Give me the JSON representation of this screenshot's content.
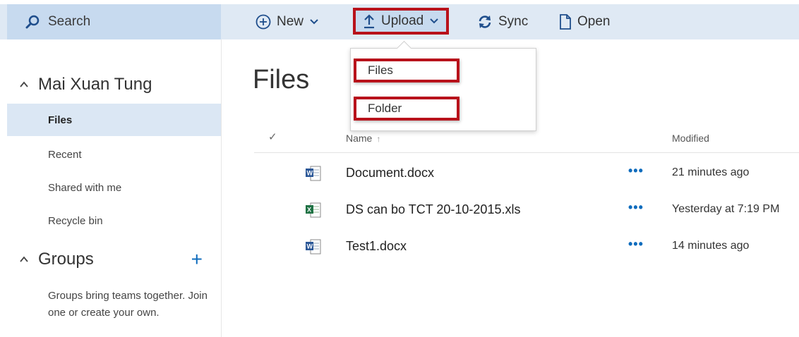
{
  "topbar": {
    "search_label": "Search",
    "new_label": "New",
    "upload_label": "Upload",
    "sync_label": "Sync",
    "open_label": "Open"
  },
  "upload_menu": {
    "items": [
      {
        "label": "Files"
      },
      {
        "label": "Folder"
      }
    ]
  },
  "sidebar": {
    "user_name": "Mai Xuan Tung",
    "items": [
      {
        "label": "Files",
        "active": true
      },
      {
        "label": "Recent"
      },
      {
        "label": "Shared with me"
      },
      {
        "label": "Recycle bin"
      }
    ],
    "groups_title": "Groups",
    "groups_add": "+",
    "groups_desc": "Groups bring teams together. Join one or create your own."
  },
  "main": {
    "title": "Files",
    "columns": {
      "check": "✓",
      "name": "Name",
      "name_sort": "↑",
      "modified": "Modified"
    },
    "files": [
      {
        "name": "Document.docx",
        "icon": "word-file-icon",
        "more": "•••",
        "modified": "21 minutes ago"
      },
      {
        "name": "DS can bo TCT 20-10-2015.xls",
        "icon": "excel-file-icon",
        "more": "•••",
        "modified": "Yesterday at 7:19 PM"
      },
      {
        "name": "Test1.docx",
        "icon": "word-file-icon",
        "more": "•••",
        "modified": "14 minutes ago"
      }
    ]
  },
  "colors": {
    "accent": "#0f6cbd",
    "highlight_border": "#b8121b",
    "topbar_bg": "#dfe9f4",
    "search_bg": "#c7daef",
    "active_nav_bg": "#dbe7f4"
  }
}
